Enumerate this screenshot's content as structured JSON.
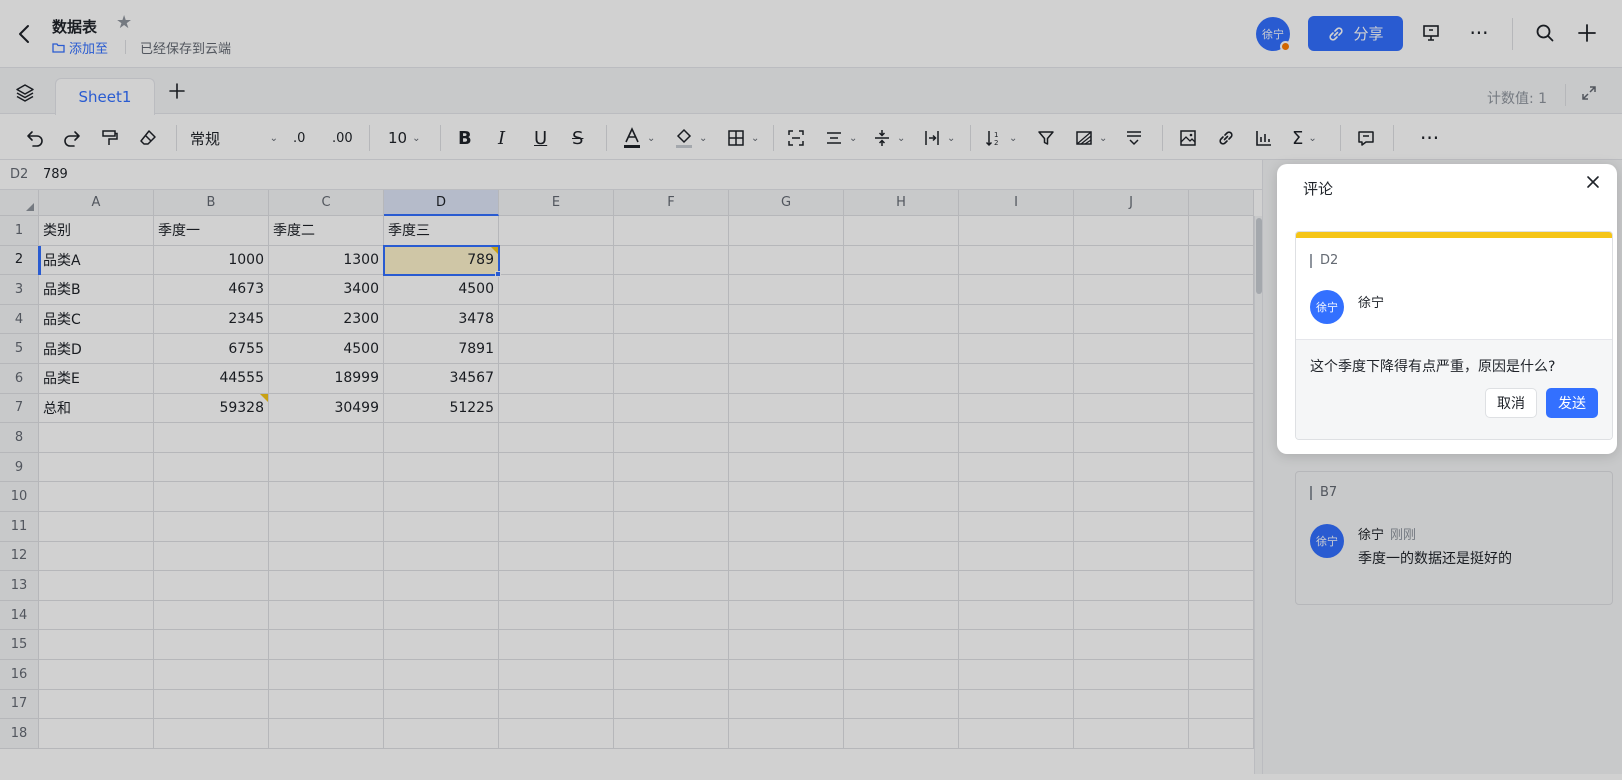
{
  "header": {
    "title": "数据表",
    "add_to": "添加至",
    "saved": "已经保存到云端",
    "avatar_text": "徐宁",
    "share_label": "分享"
  },
  "tabs": {
    "sheets": [
      "Sheet1"
    ],
    "count_label": "计数值: 1"
  },
  "toolbar": {
    "format_label": "常规",
    "font_size": "10",
    "decrease_decimal": ".0",
    "increase_decimal": ".00"
  },
  "formula_bar": {
    "ref": "D2",
    "value": "789"
  },
  "grid": {
    "columns": [
      "A",
      "B",
      "C",
      "D",
      "E",
      "F",
      "G",
      "H",
      "I",
      "J"
    ],
    "row_numbers": [
      "1",
      "2",
      "3",
      "4",
      "5",
      "6",
      "7",
      "8",
      "9",
      "10",
      "11",
      "12",
      "13",
      "14",
      "15",
      "16",
      "17",
      "18"
    ],
    "header_row": [
      "类别",
      "季度一",
      "季度二",
      "季度三"
    ],
    "rows": [
      [
        "品类A",
        "1000",
        "1300",
        "789"
      ],
      [
        "品类B",
        "4673",
        "3400",
        "4500"
      ],
      [
        "品类C",
        "2345",
        "2300",
        "3478"
      ],
      [
        "品类D",
        "6755",
        "4500",
        "7891"
      ],
      [
        "品类E",
        "44555",
        "18999",
        "34567"
      ],
      [
        "总和",
        "59328",
        "30499",
        "51225"
      ]
    ],
    "active_cell": "D2"
  },
  "comments": {
    "panel_title": "评论",
    "active": {
      "ref": "D2",
      "author": "徐宁",
      "avatar_text": "徐宁",
      "draft_text": "这个季度下降得有点严重，原因是什么?",
      "cancel_label": "取消",
      "send_label": "发送"
    },
    "existing": [
      {
        "ref": "B7",
        "author": "徐宁",
        "time": "刚刚",
        "avatar_text": "徐宁",
        "text": "季度一的数据还是挺好的"
      }
    ]
  },
  "colors": {
    "accent": "#3370ff",
    "comment_marker": "#f5c518",
    "active_cell_bg": "#fdf2cb",
    "presence_dot": "#ff7d00"
  }
}
